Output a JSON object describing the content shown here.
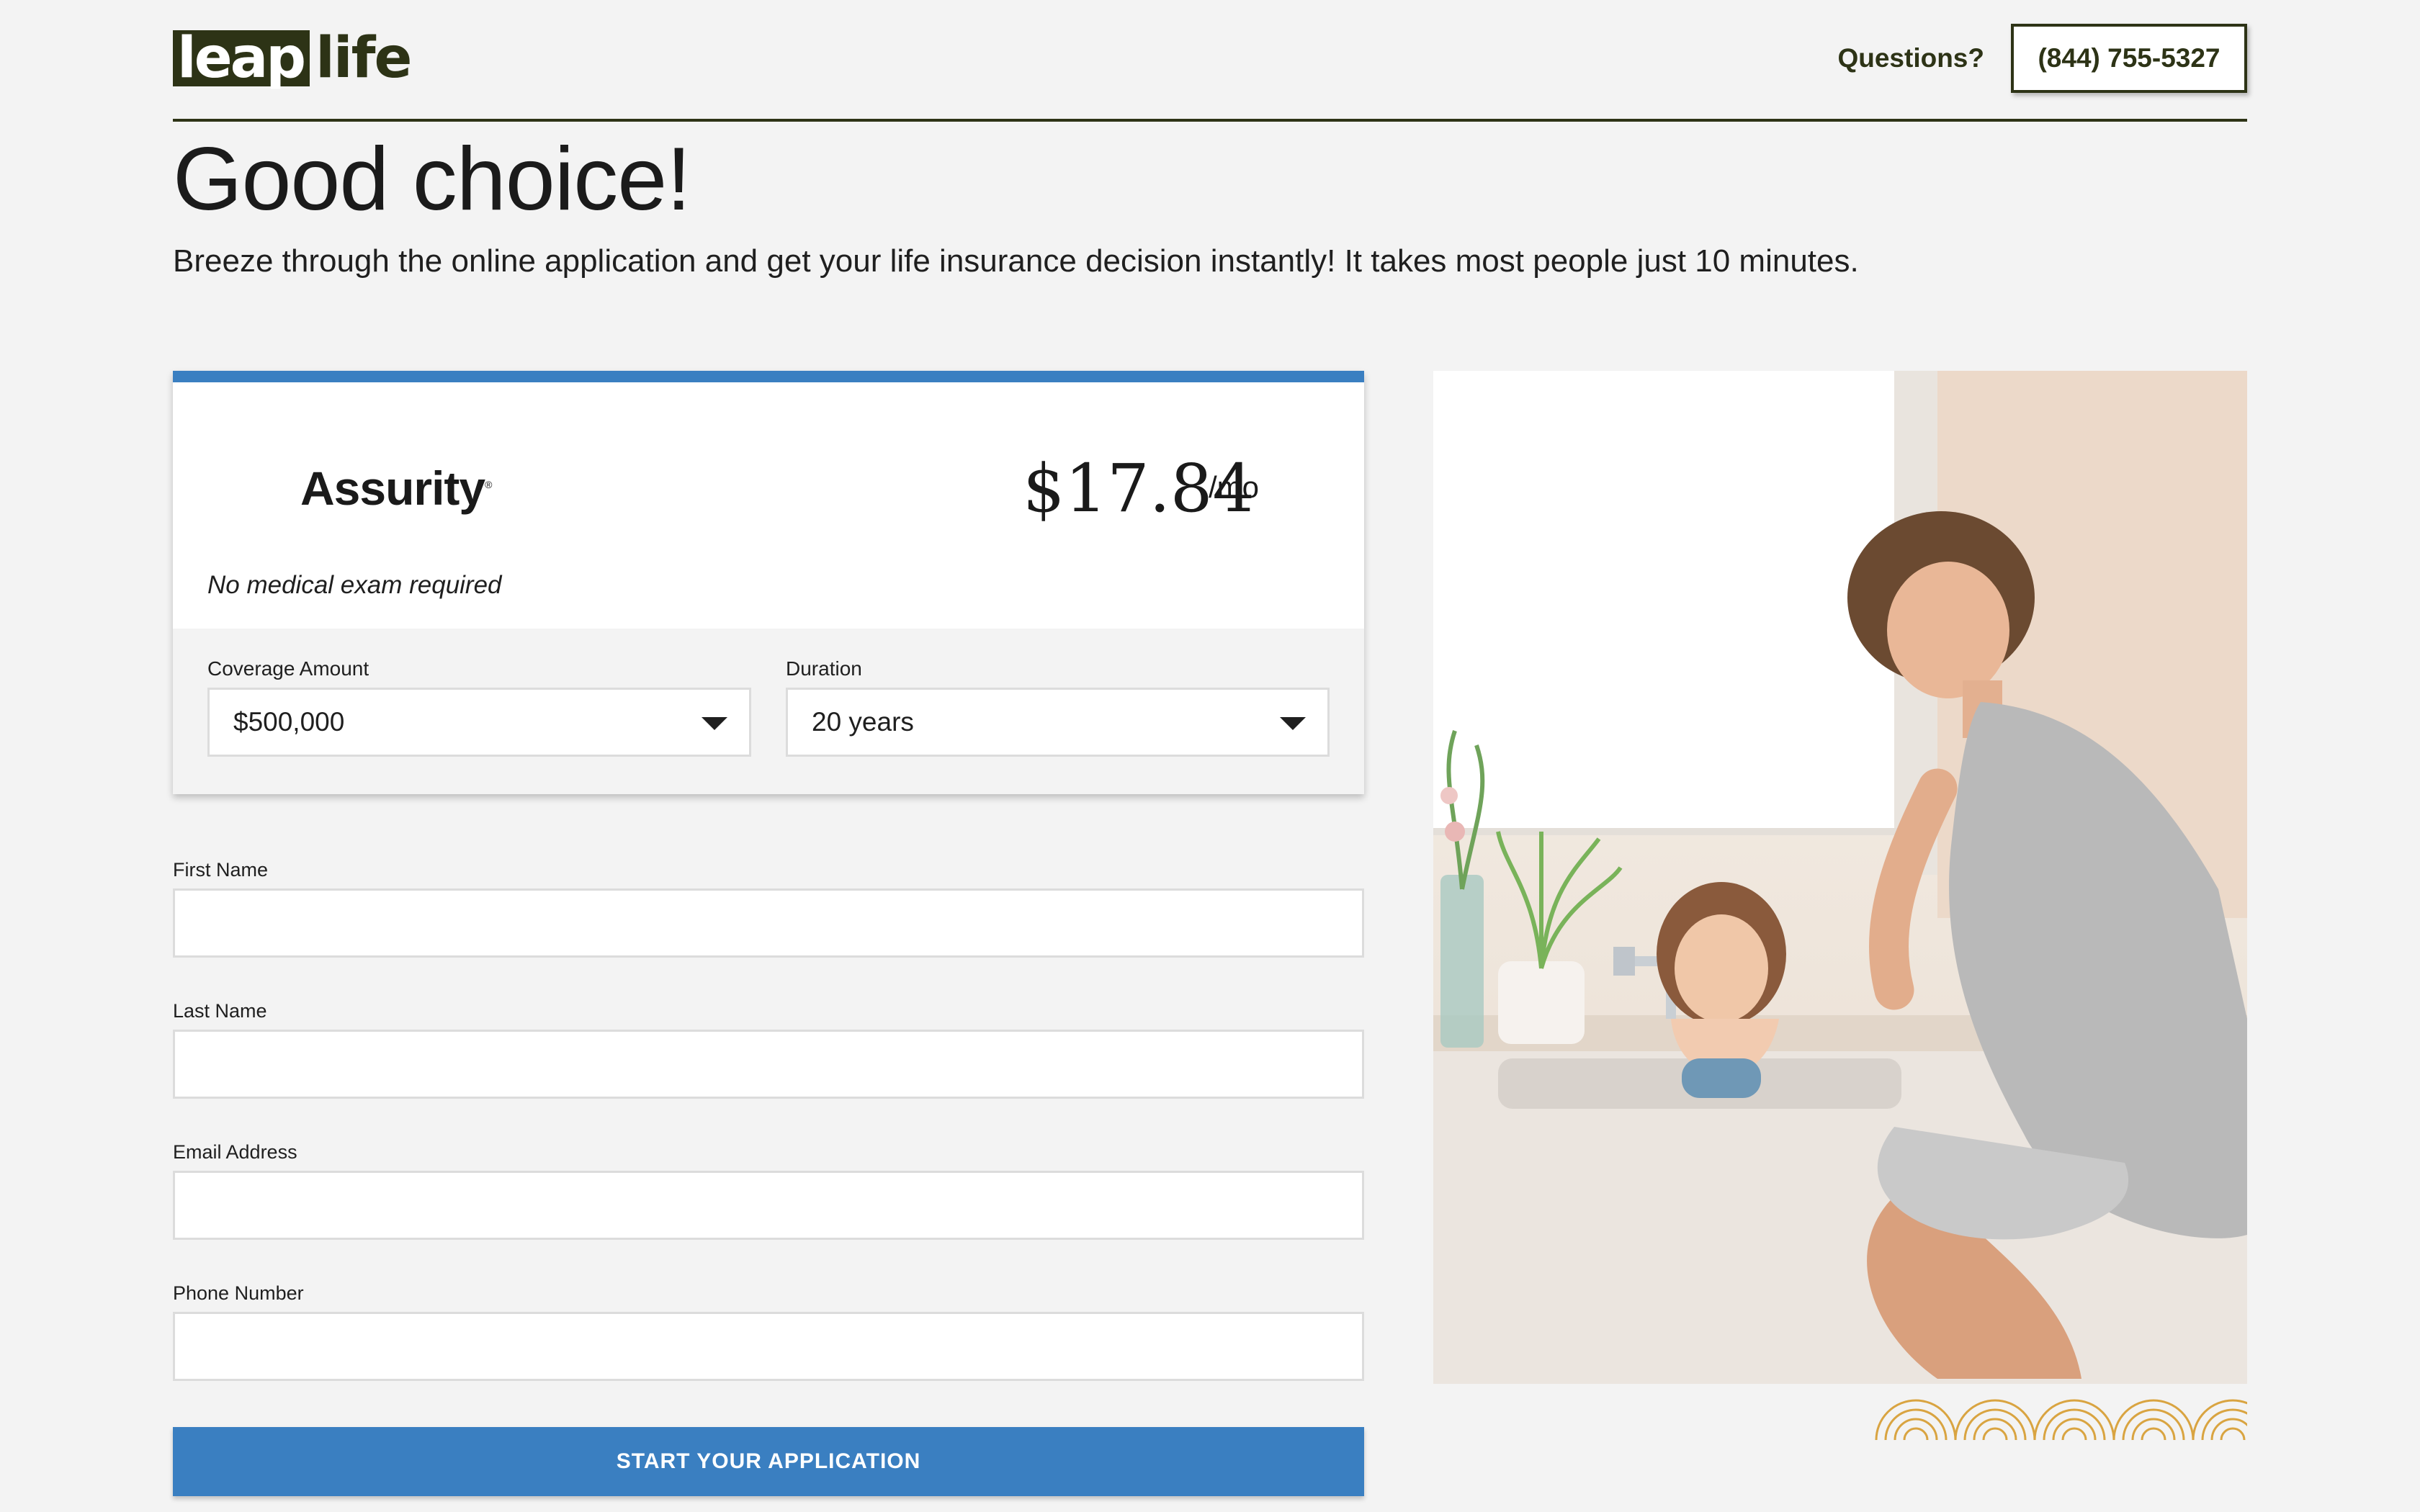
{
  "header": {
    "logo_leap": "leap",
    "logo_life": "life",
    "questions": "Questions?",
    "phone": "(844) 755-5327"
  },
  "hero": {
    "title": "Good choice!",
    "subtitle": "Breeze through the online application and get your life insurance decision instantly! It takes most people just 10 minutes."
  },
  "quote": {
    "carrier": "Assurity",
    "registered": "®",
    "price": "$17.84",
    "per": "/mo",
    "note": "No medical exam required",
    "coverage_label": "Coverage Amount",
    "coverage_value": "$500,000",
    "duration_label": "Duration",
    "duration_value": "20 years"
  },
  "form": {
    "first_name_label": "First Name",
    "last_name_label": "Last Name",
    "email_label": "Email Address",
    "phone_label": "Phone Number",
    "submit": "START YOUR APPLICATION"
  },
  "colors": {
    "brand_dark": "#2d3316",
    "accent_blue": "#3a7fc1",
    "deco_gold": "#d9a441"
  }
}
